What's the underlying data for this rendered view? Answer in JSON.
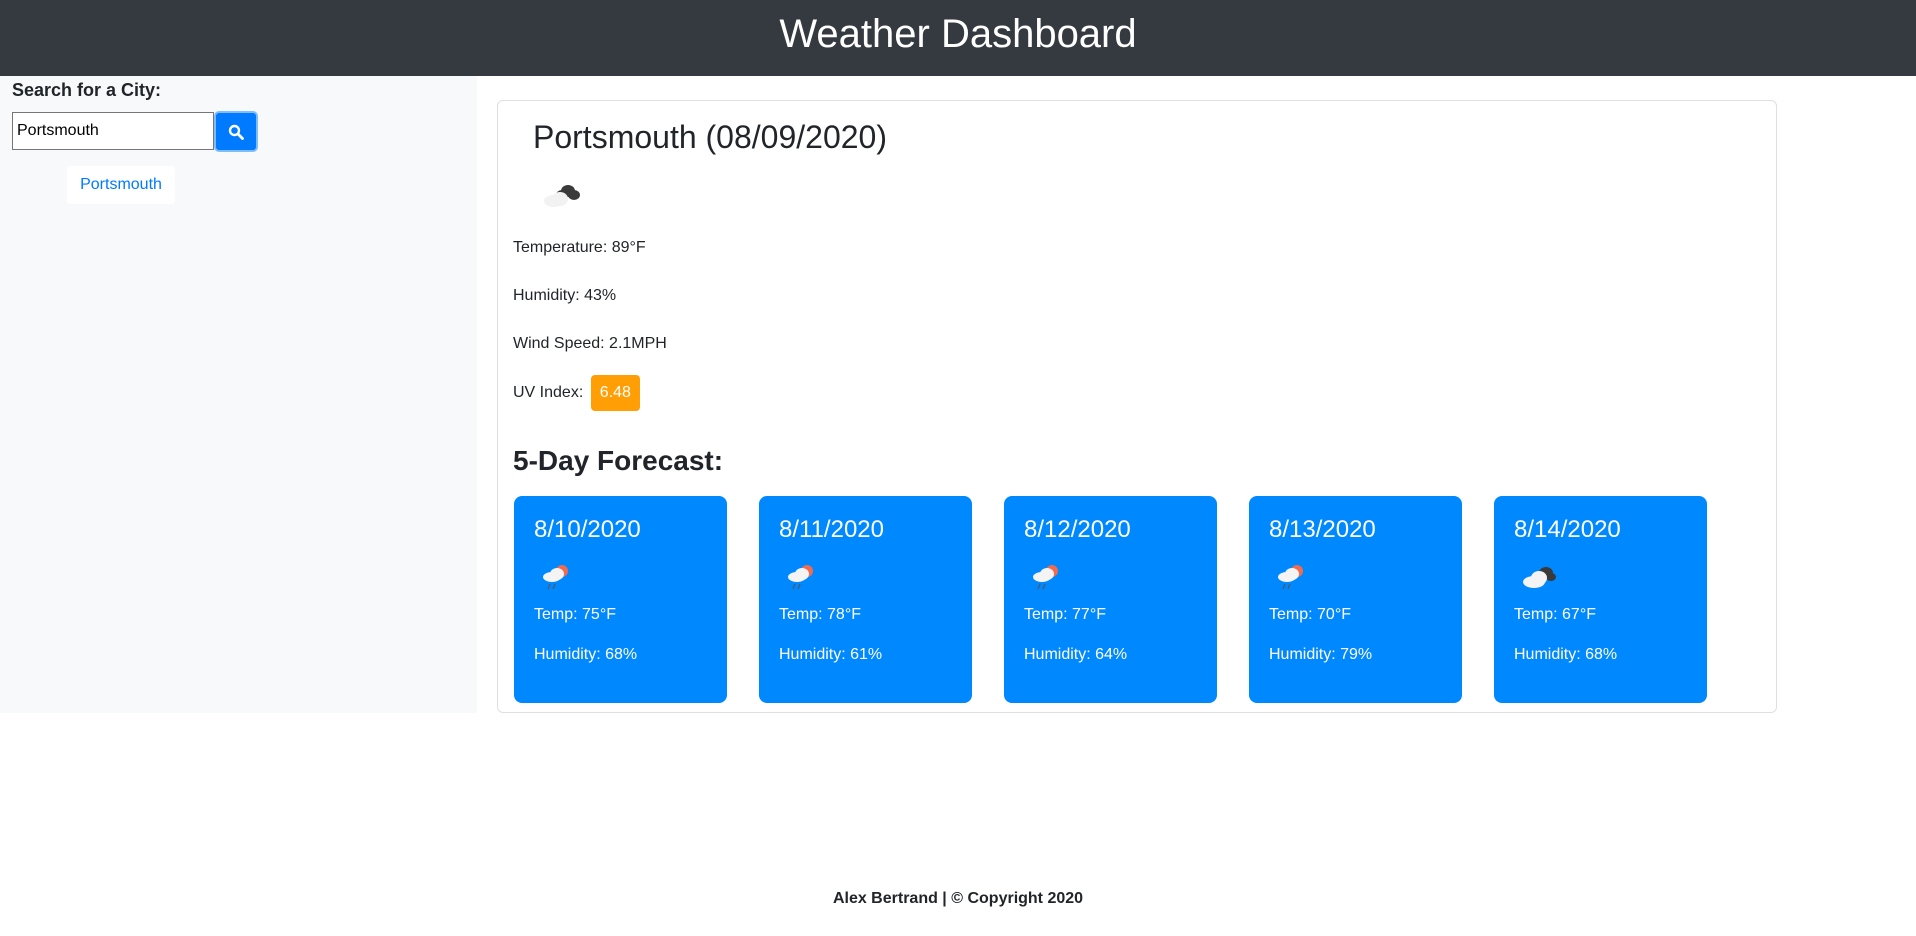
{
  "header": {
    "title": "Weather Dashboard"
  },
  "sidebar": {
    "search_label": "Search for a City:",
    "search_value": "Portsmouth",
    "search_icon": "search-icon",
    "history": [
      "Portsmouth"
    ]
  },
  "current": {
    "title": "Portsmouth (08/09/2020)",
    "icon": "broken-clouds-icon",
    "temperature": "Temperature: 89°F",
    "humidity": "Humidity: 43%",
    "wind": "Wind Speed: 2.1MPH",
    "uv_label": "UV Index: ",
    "uv_value": "6.48",
    "uv_color": "#ff9f05"
  },
  "forecast": {
    "heading": "5-Day Forecast:",
    "card_color": "#0088ff",
    "days": [
      {
        "date": "8/10/2020",
        "icon": "rain-sun-icon",
        "temp": "Temp: 75°F",
        "humidity": "Humidity: 68%"
      },
      {
        "date": "8/11/2020",
        "icon": "rain-sun-icon",
        "temp": "Temp: 78°F",
        "humidity": "Humidity: 61%"
      },
      {
        "date": "8/12/2020",
        "icon": "rain-sun-icon",
        "temp": "Temp: 77°F",
        "humidity": "Humidity: 64%"
      },
      {
        "date": "8/13/2020",
        "icon": "rain-sun-icon",
        "temp": "Temp: 70°F",
        "humidity": "Humidity: 79%"
      },
      {
        "date": "8/14/2020",
        "icon": "broken-clouds-icon",
        "temp": "Temp: 67°F",
        "humidity": "Humidity: 68%"
      }
    ]
  },
  "footer": {
    "text": "Alex Bertrand | © Copyright 2020"
  }
}
